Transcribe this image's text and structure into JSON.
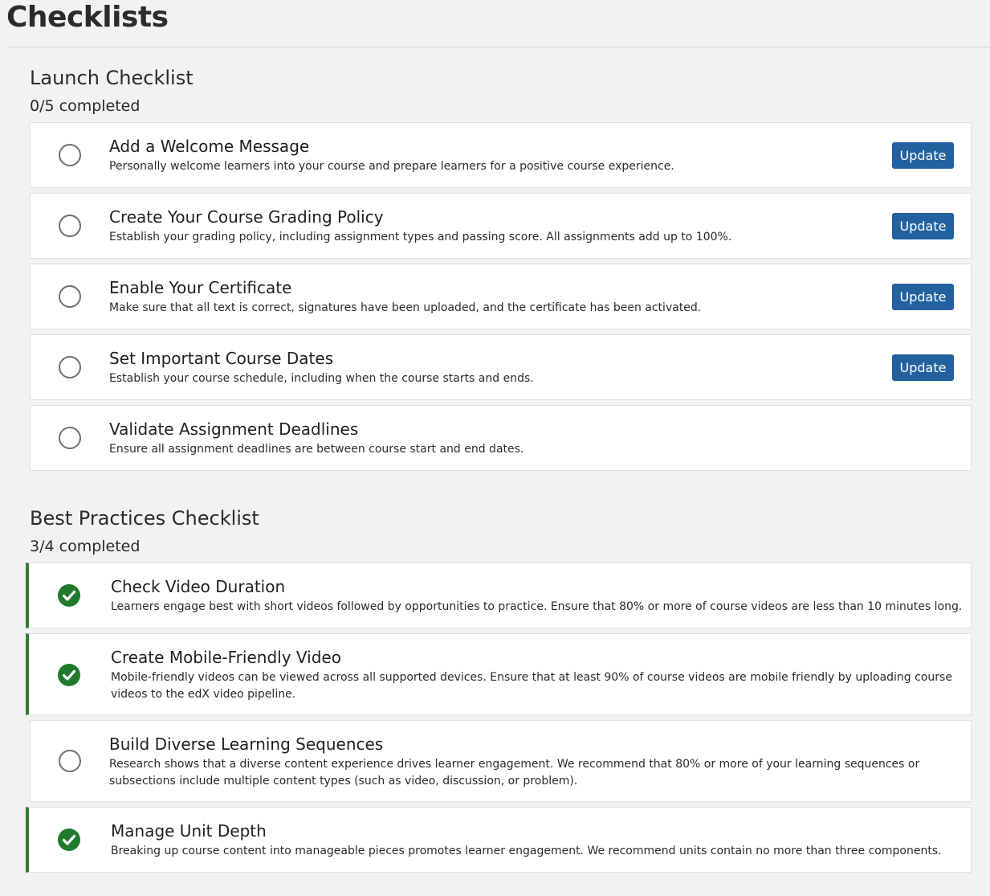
{
  "page": {
    "title": "Checklists"
  },
  "colors": {
    "accent_button": "#23619e",
    "complete_green": "#2e7d32",
    "background": "#f2f2f2"
  },
  "launch": {
    "title": "Launch Checklist",
    "progress": "0/5 completed",
    "items": [
      {
        "title": "Add a Welcome Message",
        "description": "Personally welcome learners into your course and prepare learners for a positive course experience.",
        "completed": false,
        "button": "Update"
      },
      {
        "title": "Create Your Course Grading Policy",
        "description": "Establish your grading policy, including assignment types and passing score. All assignments add up to 100%.",
        "completed": false,
        "button": "Update"
      },
      {
        "title": "Enable Your Certificate",
        "description": "Make sure that all text is correct, signatures have been uploaded, and the certificate has been activated.",
        "completed": false,
        "button": "Update"
      },
      {
        "title": "Set Important Course Dates",
        "description": "Establish your course schedule, including when the course starts and ends.",
        "completed": false,
        "button": "Update"
      },
      {
        "title": "Validate Assignment Deadlines",
        "description": "Ensure all assignment deadlines are between course start and end dates.",
        "completed": false
      }
    ]
  },
  "best_practices": {
    "title": "Best Practices Checklist",
    "progress": "3/4 completed",
    "items": [
      {
        "title": "Check Video Duration",
        "description": "Learners engage best with short videos followed by opportunities to practice. Ensure that 80% or more of course videos are less than 10 minutes long.",
        "completed": true
      },
      {
        "title": "Create Mobile-Friendly Video",
        "description": "Mobile-friendly videos can be viewed across all supported devices. Ensure that at least 90% of course videos are mobile friendly by uploading course videos to the edX video pipeline.",
        "completed": true
      },
      {
        "title": "Build Diverse Learning Sequences",
        "description": "Research shows that a diverse content experience drives learner engagement. We recommend that 80% or more of your learning sequences or subsections include multiple content types (such as video, discussion, or problem).",
        "completed": false
      },
      {
        "title": "Manage Unit Depth",
        "description": "Breaking up course content into manageable pieces promotes learner engagement. We recommend units contain no more than three components.",
        "completed": true
      }
    ]
  }
}
